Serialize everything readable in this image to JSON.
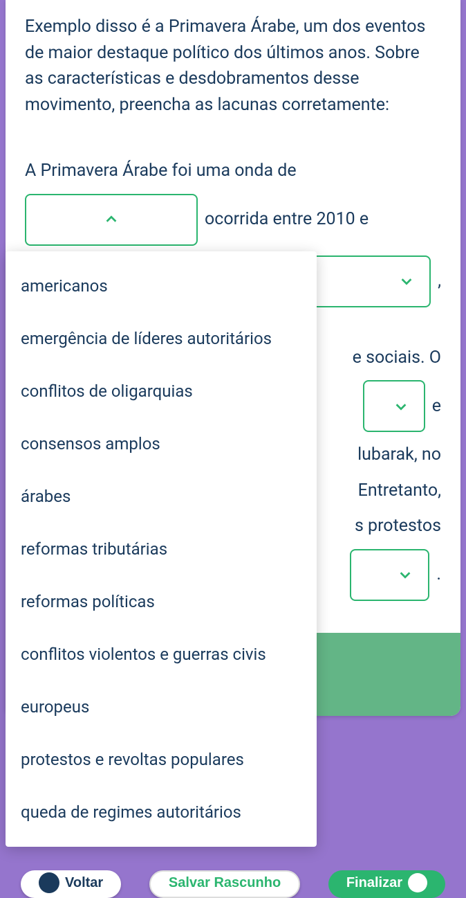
{
  "question": {
    "intro": "Exemplo disso é a Primavera Árabe, um dos eventos de maior destaque político dos últimos anos. Sobre as características e desdobramentos desse movimento, preencha as lacunas corretamente:",
    "line1_a": "A Primavera Árabe foi uma onda de",
    "line2_a": "ocorrida entre 2010 e",
    "line3_trail": ",",
    "line4_partial": "e sociais. O",
    "line5_trail": "e",
    "line6_partial": "lubarak, no",
    "line7_partial": "Entretanto,",
    "line8_partial": "s protestos",
    "line9_trail": "."
  },
  "dropdown": {
    "options": [
      "americanos",
      "emergência de líderes autoritários",
      "conflitos de oligarquias",
      "consensos amplos",
      "árabes",
      "reformas tributárias",
      "reformas políticas",
      "conflitos violentos e guerras civis",
      "europeus",
      "protestos e revoltas populares",
      "queda de regimes autoritários"
    ]
  },
  "footer": {
    "voltar": "Voltar",
    "rascunho": "Salvar Rascunho",
    "finalizar": "Finalizar"
  }
}
